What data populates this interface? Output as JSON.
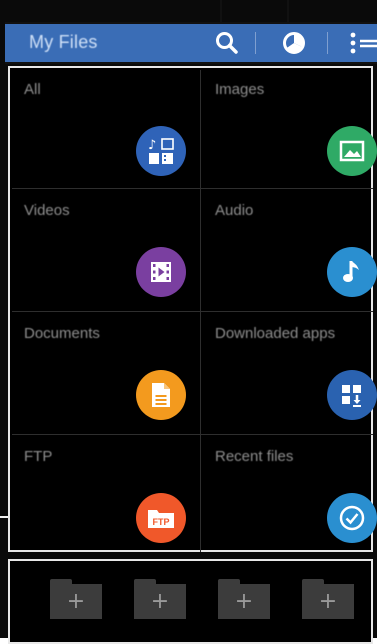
{
  "header": {
    "title": "My Files",
    "icons": [
      "search-icon",
      "storage-usage-icon",
      "more-options-icon"
    ]
  },
  "categories": [
    {
      "label": "All",
      "icon": "all-files-icon",
      "color": "#2f63b8"
    },
    {
      "label": "Images",
      "icon": "image-icon",
      "color": "#2faa66"
    },
    {
      "label": "Videos",
      "icon": "video-icon",
      "color": "#7a3fa0"
    },
    {
      "label": "Audio",
      "icon": "music-note-icon",
      "color": "#2a8fd0"
    },
    {
      "label": "Documents",
      "icon": "document-icon",
      "color": "#f39a1e"
    },
    {
      "label": "Downloaded apps",
      "icon": "apps-download-icon",
      "color": "#2a62b0"
    },
    {
      "label": "FTP",
      "icon": "ftp-icon",
      "color": "#f0582a",
      "icon_text": "FTP"
    },
    {
      "label": "Recent files",
      "icon": "recent-check-icon",
      "color": "#2a8fd0"
    }
  ],
  "shortcuts": {
    "add_label": "+",
    "count": 4
  },
  "colors": {
    "header_bg": "#3a6db6",
    "screen_bg": "#0a0a0a",
    "frame_border": "#e8e8e8"
  }
}
